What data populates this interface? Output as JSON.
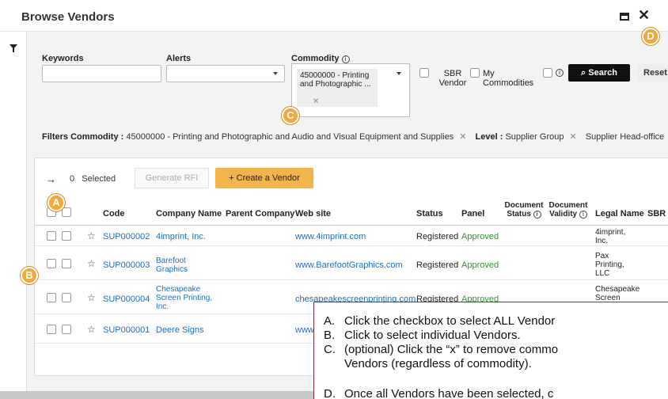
{
  "window": {
    "title": "Browse Vendors"
  },
  "search_form": {
    "keywords_label": "Keywords",
    "alerts_label": "Alerts",
    "commodity_label": "Commodity",
    "commodity_chip": "45000000 - Printing and Photographic ...",
    "sbr_vendor_label": "SBR Vendor",
    "my_commodities_label": "My Commodities",
    "search_label": "Search",
    "reset_label": "Reset"
  },
  "filters": {
    "label": "Filters",
    "items": [
      {
        "key": "Commodity :",
        "value": "45000000 - Printing and Photographic and Audio and Visual Equipment and Supplies"
      },
      {
        "key": "Level :",
        "value": "Supplier Group"
      },
      {
        "key": "",
        "value": "Supplier Head-office"
      }
    ]
  },
  "toolbar": {
    "selected_count": "0",
    "selected_label": "Selected",
    "generate_rfi_label": "Generate RFI",
    "create_vendor_label": "+ Create a Vendor"
  },
  "table": {
    "columns": {
      "code": "Code",
      "company_name": "Company Name",
      "parent_company": "Parent Company",
      "web_site": "Web site",
      "status": "Status",
      "panel": "Panel",
      "document_status": "Document Status",
      "document_validity": "Document Validity",
      "legal_name": "Legal Name",
      "sbr": "SBR C"
    },
    "rows": [
      {
        "code": "SUP000002",
        "company": "4imprint, Inc.",
        "web": "www.4imprint.com",
        "status": "Registered",
        "panel": "Approved",
        "legal": "4imprint, Inc."
      },
      {
        "code": "SUP000003",
        "company": "Barefoot Graphics",
        "web": "www.BarefootGraphics.com",
        "status": "Registered",
        "panel": "Approved",
        "legal": "Pax Printing, LLC"
      },
      {
        "code": "SUP000004",
        "company": "Chesapeake Screen Printing, Inc.",
        "web": "chesapeakescreenprinting.com",
        "status": "Registered",
        "panel": "Approved",
        "legal": "Chesapeake Screen"
      },
      {
        "code": "SUP000001",
        "company": "Deere Signs",
        "web": "www",
        "status": "",
        "panel": "",
        "legal": ""
      }
    ]
  },
  "callouts": {
    "a": "A",
    "b": "B",
    "c": "C",
    "d": "D"
  },
  "instructions": [
    {
      "letter": "A.",
      "text": "Click the checkbox to select ALL Vendor"
    },
    {
      "letter": "B.",
      "text": "Click to select individual Vendors."
    },
    {
      "letter": "C.",
      "text": "(optional) Click the “x” to remove commo"
    },
    {
      "letter": "",
      "text": "Vendors (regardless of commodity)."
    },
    {
      "letter": "D.",
      "text": "Once all Vendors have been selected, c"
    }
  ],
  "colors": {
    "accent": "#f3b54a",
    "callout": "#f3a93a",
    "link": "#1a6fc2",
    "approved": "#2a9c2a"
  }
}
